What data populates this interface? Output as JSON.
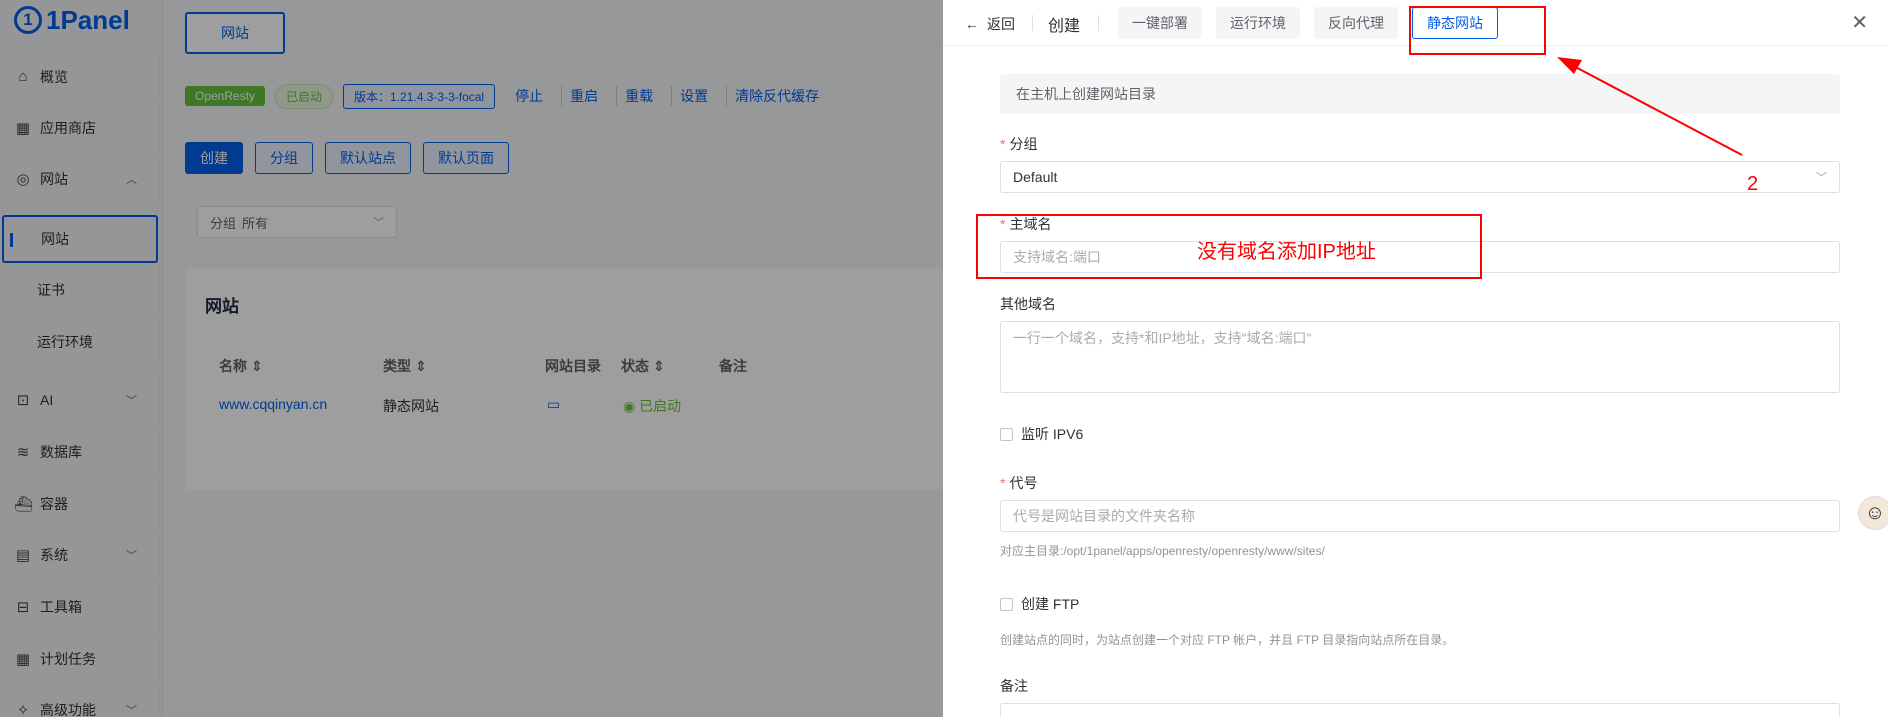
{
  "sidebar": {
    "logo": "1Panel",
    "items": [
      {
        "label": "概览",
        "icon": "home-icon"
      },
      {
        "label": "应用商店",
        "icon": "grid-icon"
      },
      {
        "label": "网站",
        "icon": "globe-icon"
      },
      {
        "label": "网站",
        "icon": ""
      },
      {
        "label": "证书",
        "icon": ""
      },
      {
        "label": "运行环境",
        "icon": ""
      },
      {
        "label": "AI",
        "icon": "robot-icon"
      },
      {
        "label": "数据库",
        "icon": "layers-icon"
      },
      {
        "label": "容器",
        "icon": "whale-icon"
      },
      {
        "label": "系统",
        "icon": "server-icon"
      },
      {
        "label": "工具箱",
        "icon": "toolbox-icon"
      },
      {
        "label": "计划任务",
        "icon": "calendar-icon"
      },
      {
        "label": "高级功能",
        "icon": "star-icon"
      }
    ]
  },
  "main": {
    "top_tab": "网站",
    "status": {
      "app": "OpenResty",
      "state": "已启动",
      "version": "版本：1.21.4.3-3-3-focal",
      "actions": [
        "停止",
        "重启",
        "重载",
        "设置",
        "清除反代缓存"
      ]
    },
    "buttons": [
      "创建",
      "分组",
      "默认站点",
      "默认页面"
    ],
    "filter": {
      "label": "分组",
      "value": "所有"
    },
    "card": {
      "title": "网站",
      "headers": [
        "名称",
        "类型",
        "网站目录",
        "状态",
        "备注"
      ],
      "row": {
        "name": "www.cqqinyan.cn",
        "type": "静态网站",
        "status": "已启动"
      }
    }
  },
  "drawer": {
    "back": "返回",
    "title": "创建",
    "tabs": [
      "一键部署",
      "运行环境",
      "反向代理",
      "静态网站"
    ],
    "active_tab": "静态网站",
    "info": "在主机上创建网站目录",
    "group": {
      "label": "分组",
      "value": "Default"
    },
    "primary_domain": {
      "label": "主域名",
      "placeholder": "支持域名:端口"
    },
    "other_domains": {
      "label": "其他域名",
      "placeholder": "一行一个域名，支持*和IP地址，支持\"域名:端口\""
    },
    "ipv6": {
      "label": "监听 IPV6"
    },
    "alias": {
      "label": "代号",
      "placeholder": "代号是网站目录的文件夹名称",
      "hint": "对应主目录:/opt/1panel/apps/openresty/openresty/www/sites/"
    },
    "ftp": {
      "label": "创建 FTP",
      "hint": "创建站点的同时，为站点创建一个对应 FTP 帐户，并且 FTP 目录指向站点所在目录。"
    },
    "remark": {
      "label": "备注"
    }
  },
  "annotations": {
    "domain_note": "没有域名添加IP地址",
    "step_number": "2",
    "color": "#ff0000"
  }
}
